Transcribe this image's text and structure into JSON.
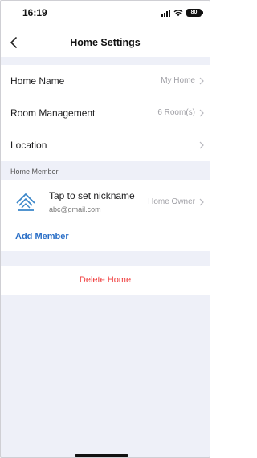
{
  "status_bar": {
    "time": "16:19",
    "battery": "80"
  },
  "nav": {
    "title": "Home Settings"
  },
  "settings": [
    {
      "label": "Home Name",
      "value": "My Home"
    },
    {
      "label": "Room Management",
      "value": "6 Room(s)"
    },
    {
      "label": "Location",
      "value": ""
    }
  ],
  "members": {
    "header": "Home Member",
    "nickname": "Tap to set nickname",
    "email": "abc@gmail.com",
    "role": "Home Owner",
    "add_label": "Add Member"
  },
  "delete_label": "Delete Home",
  "colors": {
    "accent": "#2a6fc7",
    "danger": "#ef3b3b",
    "background": "#eef0f8"
  }
}
